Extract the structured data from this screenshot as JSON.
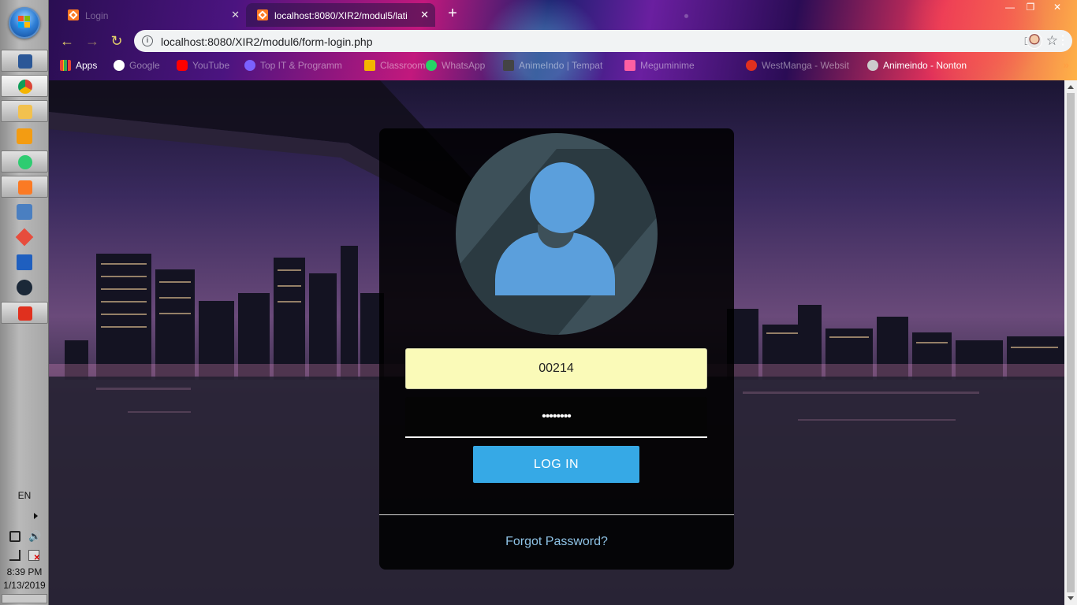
{
  "taskbar": {
    "apps": [
      {
        "name": "word",
        "color": "#2b5797"
      },
      {
        "name": "chrome",
        "color": "#db4437"
      },
      {
        "name": "file-explorer",
        "color": "#f2c14e"
      },
      {
        "name": "media-player",
        "color": "#f39c12"
      },
      {
        "name": "atom",
        "color": "#2ecc71"
      },
      {
        "name": "xampp",
        "color": "#fb7a24"
      },
      {
        "name": "virtualbox",
        "color": "#4a7fc1"
      },
      {
        "name": "git",
        "color": "#e74c3c"
      },
      {
        "name": "filezilla",
        "color": "#1f5fbf"
      },
      {
        "name": "steam",
        "color": "#1b2838"
      },
      {
        "name": "acrobat",
        "color": "#e0301e"
      }
    ],
    "language": "EN",
    "time": "8:39 PM",
    "date": "1/13/2019"
  },
  "browser": {
    "tabs": [
      {
        "title": "Login",
        "active": false
      },
      {
        "title": "localhost:8080/XIR2/modul5/lati",
        "active": true
      }
    ],
    "new_tab_label": "+",
    "url": "localhost:8080/XIR2/modul6/form-login.php",
    "bookmarks": [
      {
        "label": "Apps",
        "color": "#4285f4"
      },
      {
        "label": "Google",
        "color": "#ffffff"
      },
      {
        "label": "YouTube",
        "color": "#ff0000"
      },
      {
        "label": "Top IT & Programm",
        "color": "#7b61ff"
      },
      {
        "label": "Classroom",
        "color": "#f4b400"
      },
      {
        "label": "WhatsApp",
        "color": "#25d366"
      },
      {
        "label": "AnimeIndo | Tempat",
        "color": "#444444"
      },
      {
        "label": "Meguminime",
        "color": "#ff5fa2"
      },
      {
        "label": "WestManga - Websit",
        "color": "#e0301e"
      },
      {
        "label": "Animeindo - Nonton",
        "color": "#cccccc"
      }
    ]
  },
  "login": {
    "username_value": "00214",
    "password_value": "••••••••",
    "login_button": "LOG IN",
    "forgot_link": "Forgot Password?"
  }
}
